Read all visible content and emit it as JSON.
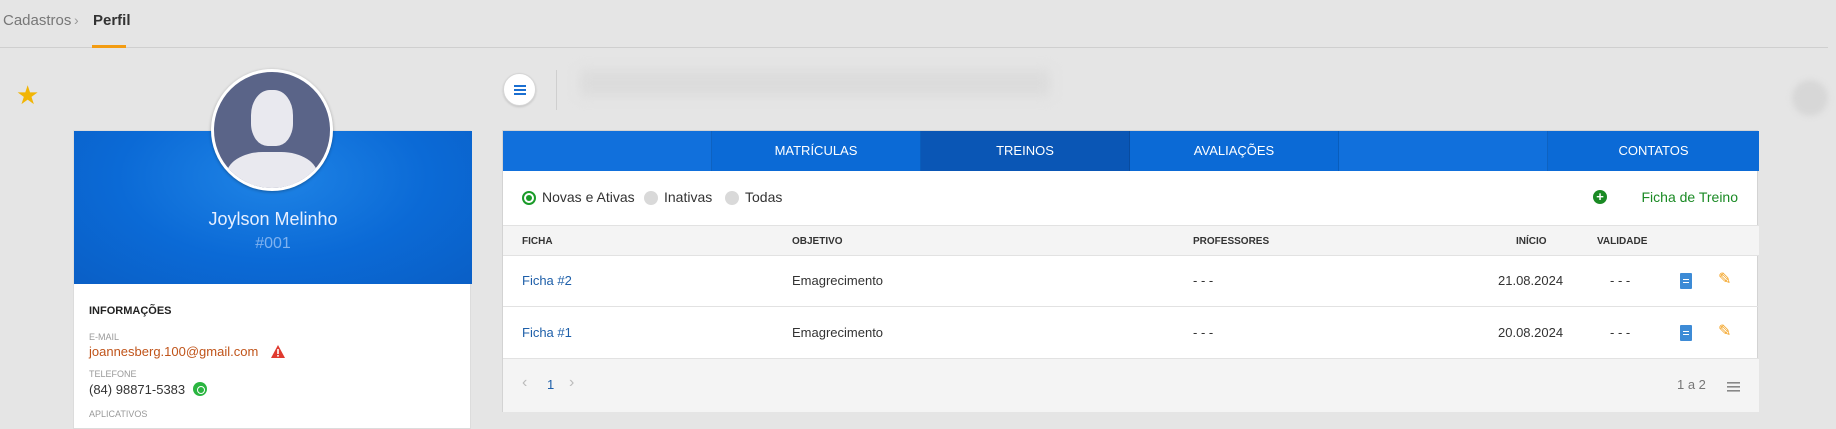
{
  "breadcrumb": {
    "parent": "Cadastros",
    "separator": "›",
    "current": "Perfil"
  },
  "profile": {
    "name": "Joylson Melinho",
    "id": "#001",
    "info_title": "INFORMAÇÕES",
    "email_label": "E-MAIL",
    "email": "joannesberg.100@gmail.com",
    "phone_label": "TELEFONE",
    "phone": "(84) 98871-5383",
    "apps_label": "APLICATIVOS"
  },
  "tabs": [
    {
      "label": ""
    },
    {
      "label": "MATRÍCULAS"
    },
    {
      "label": "TREINOS"
    },
    {
      "label": "AVALIAÇÕES"
    },
    {
      "label": ""
    },
    {
      "label": "CONTATOS"
    }
  ],
  "filters": {
    "options": [
      "Novas e Ativas",
      "Inativas",
      "Todas"
    ],
    "selected": "Novas e Ativas"
  },
  "add_action": "Ficha de Treino",
  "table": {
    "headers": [
      "FICHA",
      "OBJETIVO",
      "PROFESSORES",
      "INÍCIO",
      "VALIDADE"
    ],
    "rows": [
      {
        "ficha": "Ficha #2",
        "objetivo": "Emagrecimento",
        "professores": "- - -",
        "inicio": "21.08.2024",
        "validade": "- - -"
      },
      {
        "ficha": "Ficha #1",
        "objetivo": "Emagrecimento",
        "professores": "- - -",
        "inicio": "20.08.2024",
        "validade": "- - -"
      }
    ]
  },
  "pagination": {
    "prev": "‹",
    "page": "1",
    "next": "›",
    "summary": "1 a 2"
  },
  "colors": {
    "primary": "#0b6ad6",
    "active_tab": "#0a56b5",
    "accent": "#f39c12",
    "success": "#1a8a24"
  }
}
